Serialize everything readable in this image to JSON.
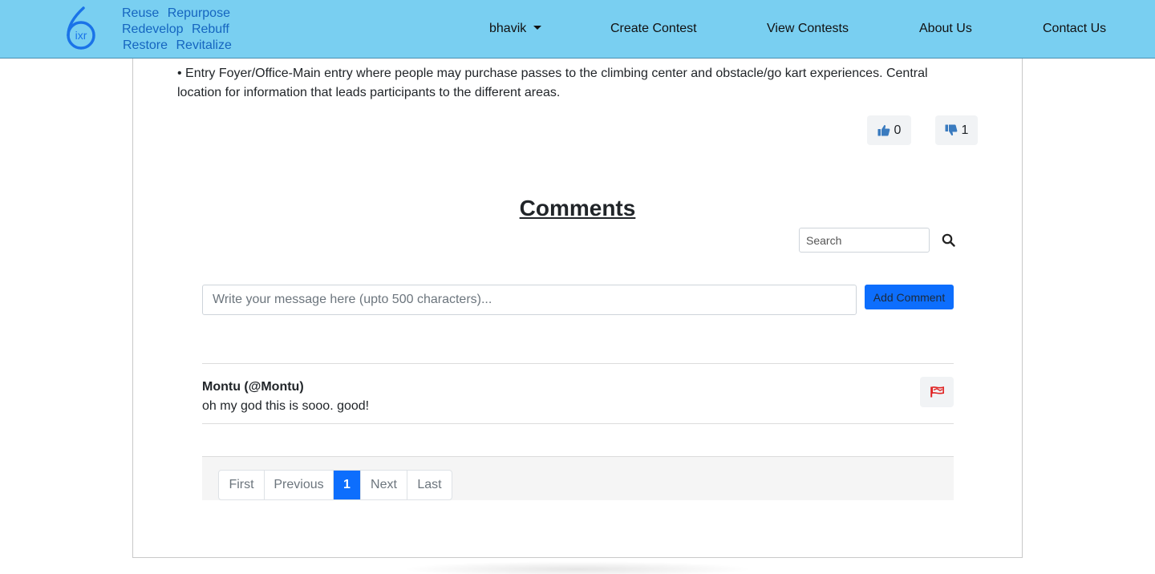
{
  "navbar": {
    "tagline": {
      "row1": [
        "Reuse",
        "Repurpose"
      ],
      "row2": [
        "Redevelop",
        "Rebuff"
      ],
      "row3": [
        "Restore",
        "Revitalize"
      ]
    },
    "logo_text": "ixr",
    "user_menu": "bhavik",
    "links": {
      "create_contest": "Create Contest",
      "view_contests": "View Contests",
      "about_us": "About Us",
      "contact_us": "Contact Us"
    },
    "colors": {
      "background": "#79cff1",
      "tagline": "#1565c0"
    }
  },
  "entry": {
    "text": "• Entry Foyer/Office-Main entry where people may purchase passes to the climbing center and obstacle/go kart experiences. Central location for information that leads participants to the different areas.",
    "likes": "0",
    "dislikes": "1"
  },
  "comments": {
    "title": "Comments",
    "search": {
      "placeholder": "Search",
      "value": ""
    },
    "new_comment": {
      "placeholder": "Write your message here (upto 500 characters)...",
      "value": ""
    },
    "add_button": "Add Comment",
    "items": [
      {
        "author": "Montu (@Montu)",
        "text": "oh my god this is sooo. good!"
      }
    ]
  },
  "pagination": {
    "first": "First",
    "previous": "Previous",
    "current": "1",
    "next": "Next",
    "last": "Last"
  },
  "colors": {
    "primary": "#0d6efd",
    "like_icon": "#3a7bbf",
    "flag_icon": "#e02424"
  }
}
